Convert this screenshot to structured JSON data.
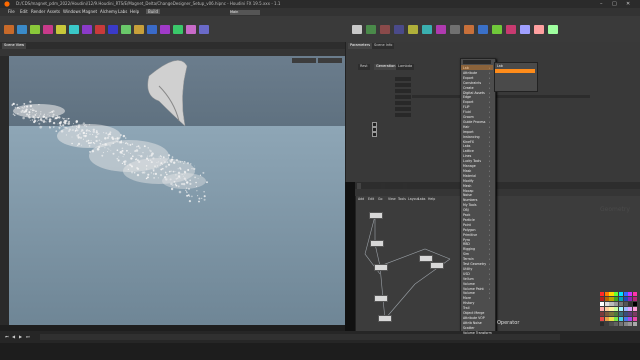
{
  "window": {
    "title": "D:/CDS/magnet_pdm_2022/Houdini/12/9.Houdini_RTS/E/Magnet_Delta/ChangeDesigner_Setup_v06.hipnc - Houdini FX 19.5.xxx - 1.1",
    "controls": [
      "–",
      "□",
      "✕"
    ]
  },
  "menubar": {
    "items": [
      "File",
      "Edit",
      "Render",
      "Assets",
      "Windows",
      "Magnet",
      "Alchemy",
      "Labs",
      "Help"
    ],
    "build": "Build",
    "desktop": "Main"
  },
  "viewport": {
    "tab_label": "Scene View",
    "path": "",
    "camera": "",
    "camera_menu": "",
    "status": ""
  },
  "parameters": {
    "tabs": [
      "Parameters",
      "Scene Info"
    ],
    "node_path": "",
    "node_type": "",
    "subtabs": [
      "Rest",
      "Generation",
      "Lambda"
    ],
    "section": "",
    "rows": [
      {
        "label": "",
        "value": "",
        "kind": "field"
      },
      {
        "label": "",
        "value": "",
        "kind": "field"
      },
      {
        "label": "",
        "value": "",
        "kind": "field"
      },
      {
        "label": "",
        "value": "",
        "kind": "field"
      },
      {
        "label": "",
        "value": "",
        "kind": "field"
      },
      {
        "label": "",
        "value": "",
        "kind": "field"
      },
      {
        "label": "",
        "value": "",
        "kind": "field"
      },
      {
        "label": "",
        "value": "",
        "kind": "check"
      },
      {
        "label": "",
        "value": "",
        "kind": "check"
      },
      {
        "label": "",
        "value": "",
        "kind": "check"
      }
    ]
  },
  "network": {
    "tabs": [
      "",
      "",
      ""
    ],
    "path": "",
    "menu": [
      "Add",
      "Edit",
      "Go",
      "View",
      "Tools",
      "Layout",
      "Labs",
      "Help"
    ],
    "nodes": [
      "",
      "",
      "",
      "",
      "",
      "",
      ""
    ],
    "watermark": "Geometry"
  },
  "tab_menu": {
    "search": "",
    "entries": [
      "Lab",
      "Attribute",
      "Export",
      "Constraints",
      "Create",
      "Digital Assets",
      "Edge",
      "Export",
      "FLIP",
      "Fluid",
      "Groom",
      "Guide Process",
      "Hair",
      "Import",
      "Instancing",
      "KineFX",
      "Labs",
      "Lattice",
      "Lines",
      "Lucky Tools",
      "Manage",
      "Mask",
      "Material",
      "Modify",
      "Mesh",
      "Mocap",
      "Noise",
      "Numbers",
      "My Tools",
      "OBJ",
      "Pack",
      "Particle",
      "Point",
      "Polygon",
      "Primitive",
      "Pyro",
      "RBD",
      "Rigging",
      "Sim",
      "Terrain",
      "Test Geometry",
      "Utility",
      "USD",
      "Vellum",
      "Volume",
      "Volume Paint",
      "Volume",
      "More",
      "History",
      "Trail",
      "Object Merge",
      "Attribute VOP",
      "Attrib Noise",
      "Scatter",
      "Volume Transform"
    ],
    "submenu": [
      "Lab",
      "",
      "",
      "",
      ""
    ],
    "footer_search": ""
  },
  "current_tool": "Operator",
  "timeline": {
    "frame": "1",
    "end_label": ""
  },
  "palette_colors": [
    "#ff2a2a",
    "#ff7a00",
    "#ffd800",
    "#66ff33",
    "#00e0ff",
    "#3366ff",
    "#cc33ff",
    "#ff33aa",
    "#b81d1d",
    "#b86200",
    "#b8a400",
    "#3fa81f",
    "#00a3b8",
    "#2448b8",
    "#8f24b8",
    "#b82478",
    "#ffffff",
    "#dddddd",
    "#bbbbbb",
    "#999999",
    "#777777",
    "#555555",
    "#333333",
    "#000000",
    "#ffaaaa",
    "#ffd0a0",
    "#fff3a0",
    "#c8ffa0",
    "#a0f3ff",
    "#a0b8ff",
    "#e3a0ff",
    "#ffa0d8",
    "#7a3b3b",
    "#7a5a3b",
    "#7a733b",
    "#4d7a3b",
    "#3b6f7a",
    "#3b4d7a",
    "#5f3b7a",
    "#7a3b62",
    "#e84848",
    "#e8a048",
    "#e8e048",
    "#78e848",
    "#48d0e8",
    "#4878e8",
    "#a848e8",
    "#e848a8",
    "#2b2b2b",
    "#3d3d3d",
    "#4f4f4f",
    "#616161",
    "#737373",
    "#858585",
    "#979797",
    "#a9a9a9"
  ]
}
